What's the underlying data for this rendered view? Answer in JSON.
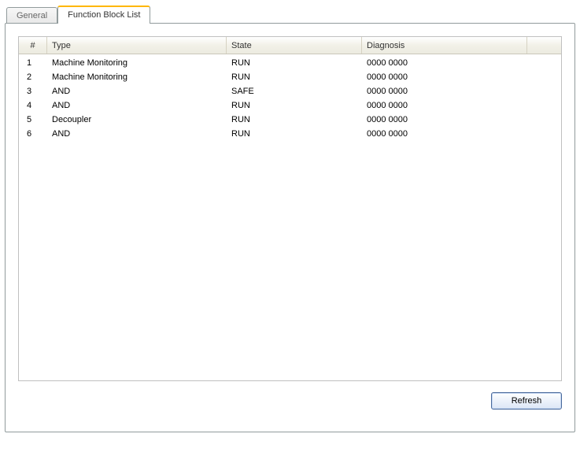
{
  "tabs": {
    "general": "General",
    "fbl": "Function Block List"
  },
  "columns": {
    "num": "#",
    "type": "Type",
    "state": "State",
    "diag": "Diagnosis"
  },
  "rows": [
    {
      "num": "1",
      "type": "Machine Monitoring",
      "state": "RUN",
      "diag": "0000 0000"
    },
    {
      "num": "2",
      "type": "Machine Monitoring",
      "state": "RUN",
      "diag": "0000 0000"
    },
    {
      "num": "3",
      "type": "AND",
      "state": "SAFE",
      "diag": "0000 0000"
    },
    {
      "num": "4",
      "type": "AND",
      "state": "RUN",
      "diag": "0000 0000"
    },
    {
      "num": "5",
      "type": "Decoupler",
      "state": "RUN",
      "diag": "0000 0000"
    },
    {
      "num": "6",
      "type": "AND",
      "state": "RUN",
      "diag": "0000 0000"
    }
  ],
  "buttons": {
    "refresh": "Refresh"
  }
}
